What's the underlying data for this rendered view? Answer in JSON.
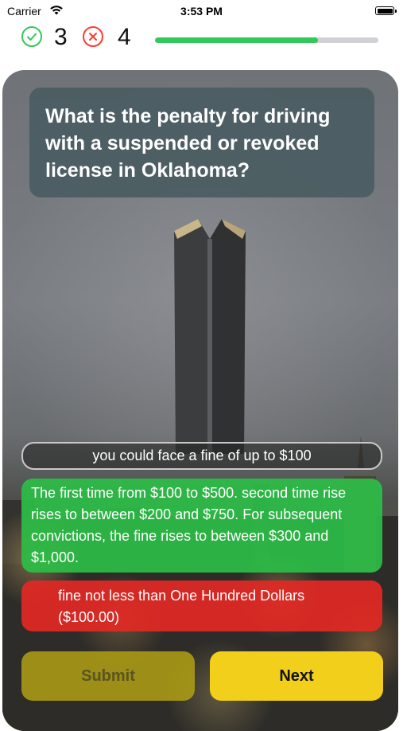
{
  "status_bar": {
    "carrier": "Carrier",
    "time": "3:53 PM"
  },
  "score": {
    "correct": "3",
    "wrong": "4",
    "progress_fraction": 0.73,
    "colors": {
      "correct": "#34c759",
      "wrong": "#ff3b30",
      "progress": "#34c759"
    }
  },
  "question": {
    "text": "What is the penalty for driving with a suspended or revoked license in Oklahoma?"
  },
  "answers": [
    {
      "text": "you could face a fine of up to $100",
      "state": "neutral"
    },
    {
      "text": "The first time from $100 to $500. second time rise rises to between $200 and $750. For subsequent convictions, the fine rises to between $300 and $1,000.",
      "state": "correct",
      "color": "#2cbe46"
    },
    {
      "text": "fine not less than One Hundred Dollars ($100.00)",
      "state": "wrong",
      "color": "#e62824"
    }
  ],
  "buttons": {
    "submit_label": "Submit",
    "next_label": "Next"
  },
  "icons": {
    "correct": "checkmark-circle-icon",
    "wrong": "x-circle-icon",
    "wifi": "wifi-icon",
    "battery": "battery-icon"
  }
}
